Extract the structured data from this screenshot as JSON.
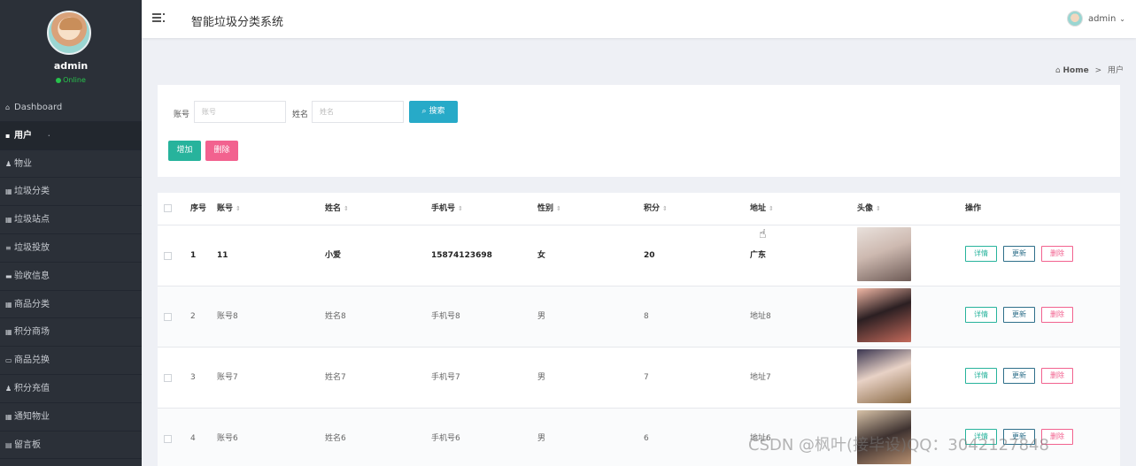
{
  "app": {
    "title": "智能垃圾分类系统"
  },
  "sidebar": {
    "username": "admin",
    "status": "Online",
    "items": [
      {
        "icon": "home-icon",
        "glyph": "⌂",
        "label": "Dashboard"
      },
      {
        "icon": "user-icon",
        "glyph": "▪",
        "label": "用户",
        "active": true
      },
      {
        "icon": "person-icon",
        "glyph": "♟",
        "label": "物业"
      },
      {
        "icon": "grid-icon",
        "glyph": "▦",
        "label": "垃圾分类"
      },
      {
        "icon": "grid-icon",
        "glyph": "▦",
        "label": "垃圾站点"
      },
      {
        "icon": "list-icon",
        "glyph": "≡",
        "label": "垃圾投放"
      },
      {
        "icon": "message-icon",
        "glyph": "▬",
        "label": "验收信息"
      },
      {
        "icon": "grid-icon",
        "glyph": "▦",
        "label": "商品分类"
      },
      {
        "icon": "grid-icon",
        "glyph": "▦",
        "label": "积分商场"
      },
      {
        "icon": "card-icon",
        "glyph": "▭",
        "label": "商品兑换"
      },
      {
        "icon": "person-icon",
        "glyph": "♟",
        "label": "积分充值"
      },
      {
        "icon": "grid-icon",
        "glyph": "▦",
        "label": "通知物业"
      },
      {
        "icon": "book-icon",
        "glyph": "▤",
        "label": "留言板"
      }
    ]
  },
  "topbar": {
    "user": "admin"
  },
  "breadcrumb": {
    "home": "Home",
    "sep": ">",
    "current": "用户"
  },
  "search": {
    "account_label": "账号",
    "account_placeholder": "账号",
    "name_label": "姓名",
    "name_placeholder": "姓名",
    "search_button": "搜索",
    "add_button": "增加",
    "delete_button": "删除"
  },
  "table": {
    "headers": [
      "序号",
      "账号",
      "姓名",
      "手机号",
      "性别",
      "积分",
      "地址",
      "头像",
      "操作"
    ],
    "rows": [
      {
        "no": "1",
        "account": "11",
        "name": "小爱",
        "phone": "15874123698",
        "gender": "女",
        "points": "20",
        "address": "广东"
      },
      {
        "no": "2",
        "account": "账号8",
        "name": "姓名8",
        "phone": "手机号8",
        "gender": "男",
        "points": "8",
        "address": "地址8"
      },
      {
        "no": "3",
        "account": "账号7",
        "name": "姓名7",
        "phone": "手机号7",
        "gender": "男",
        "points": "7",
        "address": "地址7"
      },
      {
        "no": "4",
        "account": "账号6",
        "name": "姓名6",
        "phone": "手机号6",
        "gender": "男",
        "points": "6",
        "address": "地址6"
      }
    ],
    "actions": {
      "detail": "详情",
      "update": "更新",
      "remove": "删除"
    }
  },
  "watermark": "CSDN @枫叶(接毕设)QQ：3042127848",
  "colors": {
    "sidebar": "#2b3038",
    "primary": "#27aac8",
    "success": "#27b39c",
    "danger": "#f2628f"
  }
}
